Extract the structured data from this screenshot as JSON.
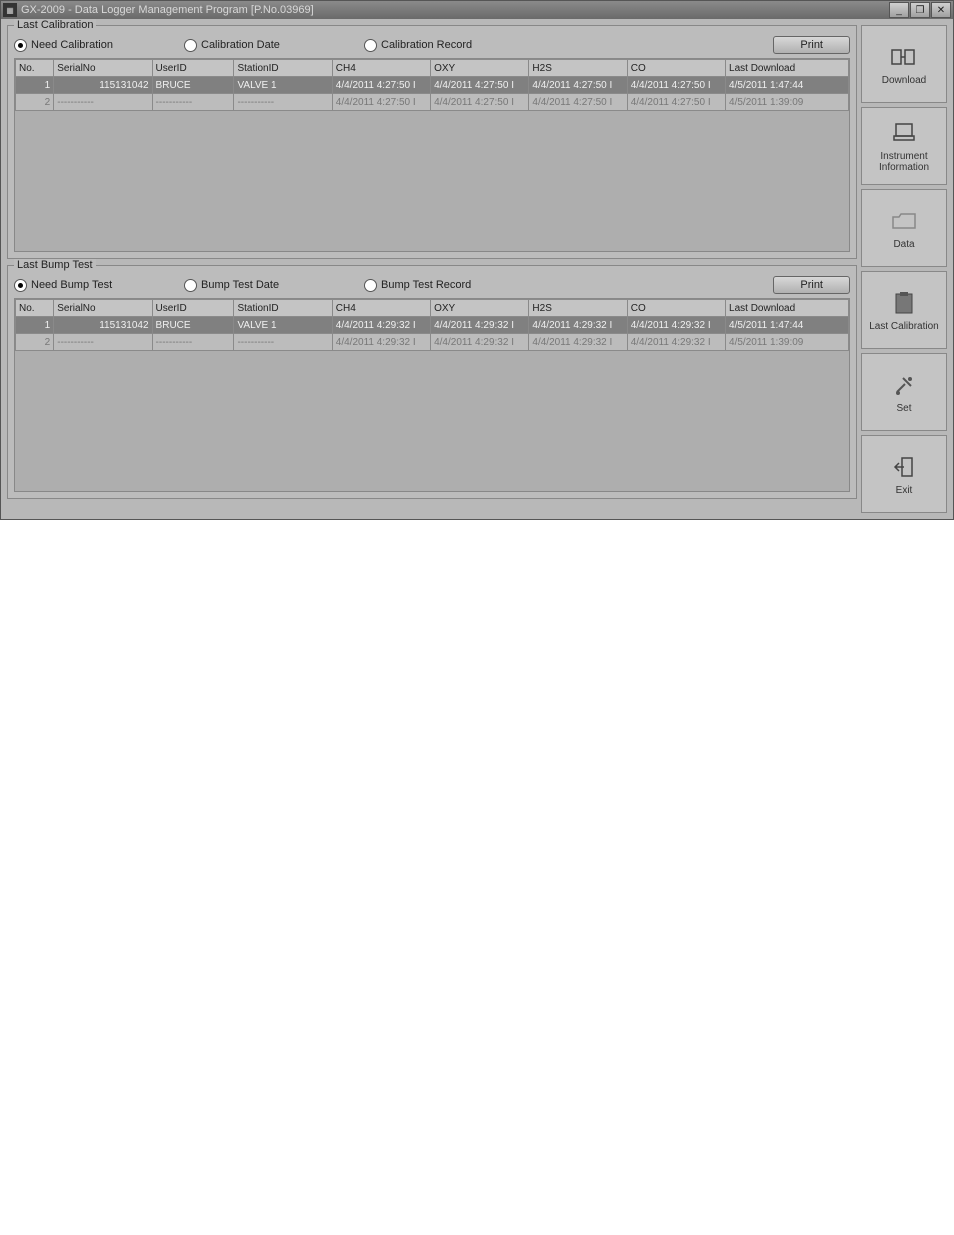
{
  "title": "GX-2009 - Data Logger Management Program [P.No.03969]",
  "groups": {
    "calibration": {
      "title": "Last Calibration",
      "radio1": "Need Calibration",
      "radio2": "Calibration Date",
      "radio3": "Calibration Record",
      "print": "Print",
      "headers": [
        "No.",
        "SerialNo",
        "UserID",
        "StationID",
        "CH4",
        "OXY",
        "H2S",
        "CO",
        "Last Download"
      ],
      "rows": [
        {
          "no": "1",
          "serial": "115131042",
          "user": "BRUCE",
          "station": "VALVE 1",
          "ch4": "4/4/2011 4:27:50 I",
          "oxy": "4/4/2011 4:27:50 I",
          "h2s": "4/4/2011 4:27:50 I",
          "co": "4/4/2011 4:27:50 I",
          "dl": "4/5/2011 1:47:44",
          "sel": true
        },
        {
          "no": "2",
          "serial": "-----------",
          "user": "-----------",
          "station": "-----------",
          "ch4": "4/4/2011 4:27:50 I",
          "oxy": "4/4/2011 4:27:50 I",
          "h2s": "4/4/2011 4:27:50 I",
          "co": "4/4/2011 4:27:50 I",
          "dl": "4/5/2011 1:39:09",
          "sel": false
        }
      ]
    },
    "bumptest": {
      "title": "Last Bump Test",
      "radio1": "Need Bump Test",
      "radio2": "Bump Test Date",
      "radio3": "Bump Test Record",
      "print": "Print",
      "headers": [
        "No.",
        "SerialNo",
        "UserID",
        "StationID",
        "CH4",
        "OXY",
        "H2S",
        "CO",
        "Last Download"
      ],
      "rows": [
        {
          "no": "1",
          "serial": "115131042",
          "user": "BRUCE",
          "station": "VALVE 1",
          "ch4": "4/4/2011 4:29:32 I",
          "oxy": "4/4/2011 4:29:32 I",
          "h2s": "4/4/2011 4:29:32 I",
          "co": "4/4/2011 4:29:32 I",
          "dl": "4/5/2011 1:47:44",
          "sel": true
        },
        {
          "no": "2",
          "serial": "-----------",
          "user": "-----------",
          "station": "-----------",
          "ch4": "4/4/2011 4:29:32 I",
          "oxy": "4/4/2011 4:29:32 I",
          "h2s": "4/4/2011 4:29:32 I",
          "co": "4/4/2011 4:29:32 I",
          "dl": "4/5/2011 1:39:09",
          "sel": false
        }
      ]
    }
  },
  "sidebar": {
    "download": "Download",
    "instrument": "Instrument Information",
    "data": "Data",
    "lastcal": "Last Calibration",
    "set": "Set",
    "exit": "Exit"
  }
}
